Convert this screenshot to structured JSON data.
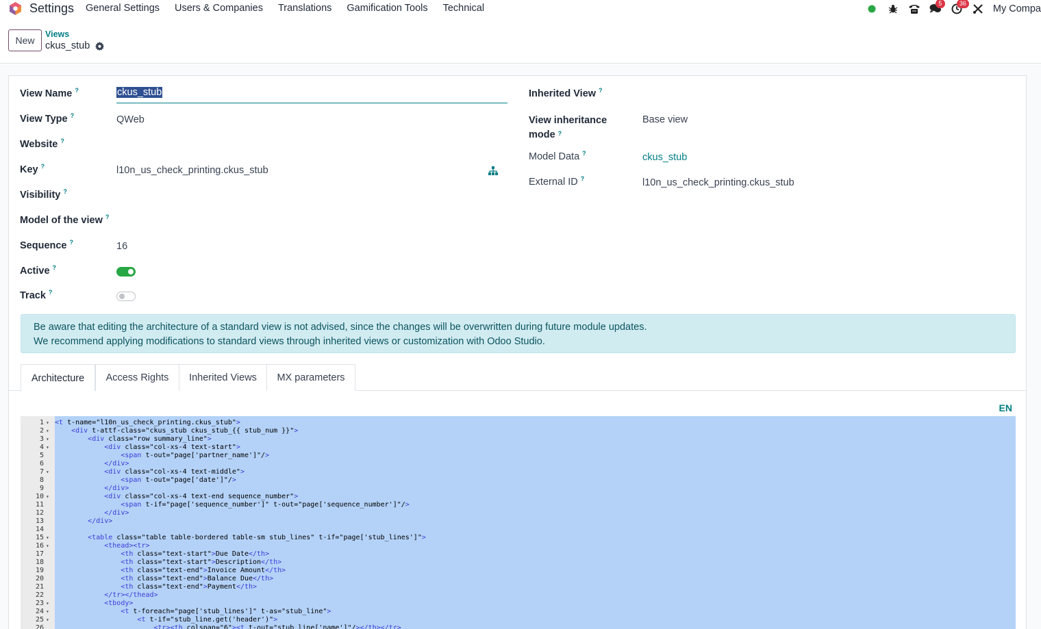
{
  "navbar": {
    "app_name": "Settings",
    "menu": [
      "General Settings",
      "Users & Companies",
      "Translations",
      "Gamification Tools",
      "Technical"
    ],
    "systray": {
      "messages_badge": "5",
      "activities_badge": "36",
      "company": "My Compa"
    }
  },
  "control_panel": {
    "new_label": "New",
    "breadcrumb_parent": "Views",
    "breadcrumb_current": "ckus_stub"
  },
  "form": {
    "left": {
      "view_name_label": "View Name",
      "view_name_value": "ckus_stub",
      "view_type_label": "View Type",
      "view_type_value": "QWeb",
      "website_label": "Website",
      "key_label": "Key",
      "key_value": "l10n_us_check_printing.ckus_stub",
      "visibility_label": "Visibility",
      "model_label": "Model of the view",
      "sequence_label": "Sequence",
      "sequence_value": "16",
      "active_label": "Active",
      "active_value": true,
      "track_label": "Track",
      "track_value": false
    },
    "right": {
      "inherited_view_label": "Inherited View",
      "inheritance_mode_label_1": "View inheritance",
      "inheritance_mode_label_2": "mode",
      "inheritance_mode_value": "Base view",
      "model_data_label": "Model Data",
      "model_data_value": "ckus_stub",
      "external_id_label": "External ID",
      "external_id_value": "l10n_us_check_printing.ckus_stub"
    },
    "help_mark": "?"
  },
  "alert": {
    "line1": "Be aware that editing the architecture of a standard view is not advised, since the changes will be overwritten during future module updates.",
    "line2": "We recommend applying modifications to standard views through inherited views or customization with Odoo Studio."
  },
  "tabs": [
    "Architecture",
    "Access Rights",
    "Inherited Views",
    "MX parameters"
  ],
  "editor": {
    "lang": "EN",
    "lines": [
      "<t t-name=\"l10n_us_check_printing.ckus_stub\">",
      "    <div t-attf-class=\"ckus_stub ckus_stub_{{ stub_num }}\">",
      "        <div class=\"row summary_line\">",
      "            <div class=\"col-xs-4 text-start\">",
      "                <span t-out=\"page['partner_name']\"/>",
      "            </div>",
      "            <div class=\"col-xs-4 text-middle\">",
      "                <span t-out=\"page['date']\"/>",
      "            </div>",
      "            <div class=\"col-xs-4 text-end sequence_number\">",
      "                <span t-if=\"page['sequence_number']\" t-out=\"page['sequence_number']\"/>",
      "            </div>",
      "        </div>",
      "",
      "        <table class=\"table table-bordered table-sm stub_lines\" t-if=\"page['stub_lines']\">",
      "            <thead><tr>",
      "                <th class=\"text-start\">Due Date</th>",
      "                <th class=\"text-start\">Description</th>",
      "                <th class=\"text-end\">Invoice Amount</th>",
      "                <th class=\"text-end\">Balance Due</th>",
      "                <th class=\"text-end\">Payment</th>",
      "            </tr></thead>",
      "            <tbody>",
      "                <t t-foreach=\"page['stub_lines']\" t-as=\"stub_line\">",
      "                    <t t-if=\"stub_line.get('header')\">",
      "                        <tr><th colspan=\"6\"><t t-out=\"stub_line['name']\"/></th></tr>"
    ],
    "fold_lines": [
      1,
      2,
      3,
      4,
      7,
      10,
      15,
      16,
      23,
      24,
      25
    ]
  }
}
